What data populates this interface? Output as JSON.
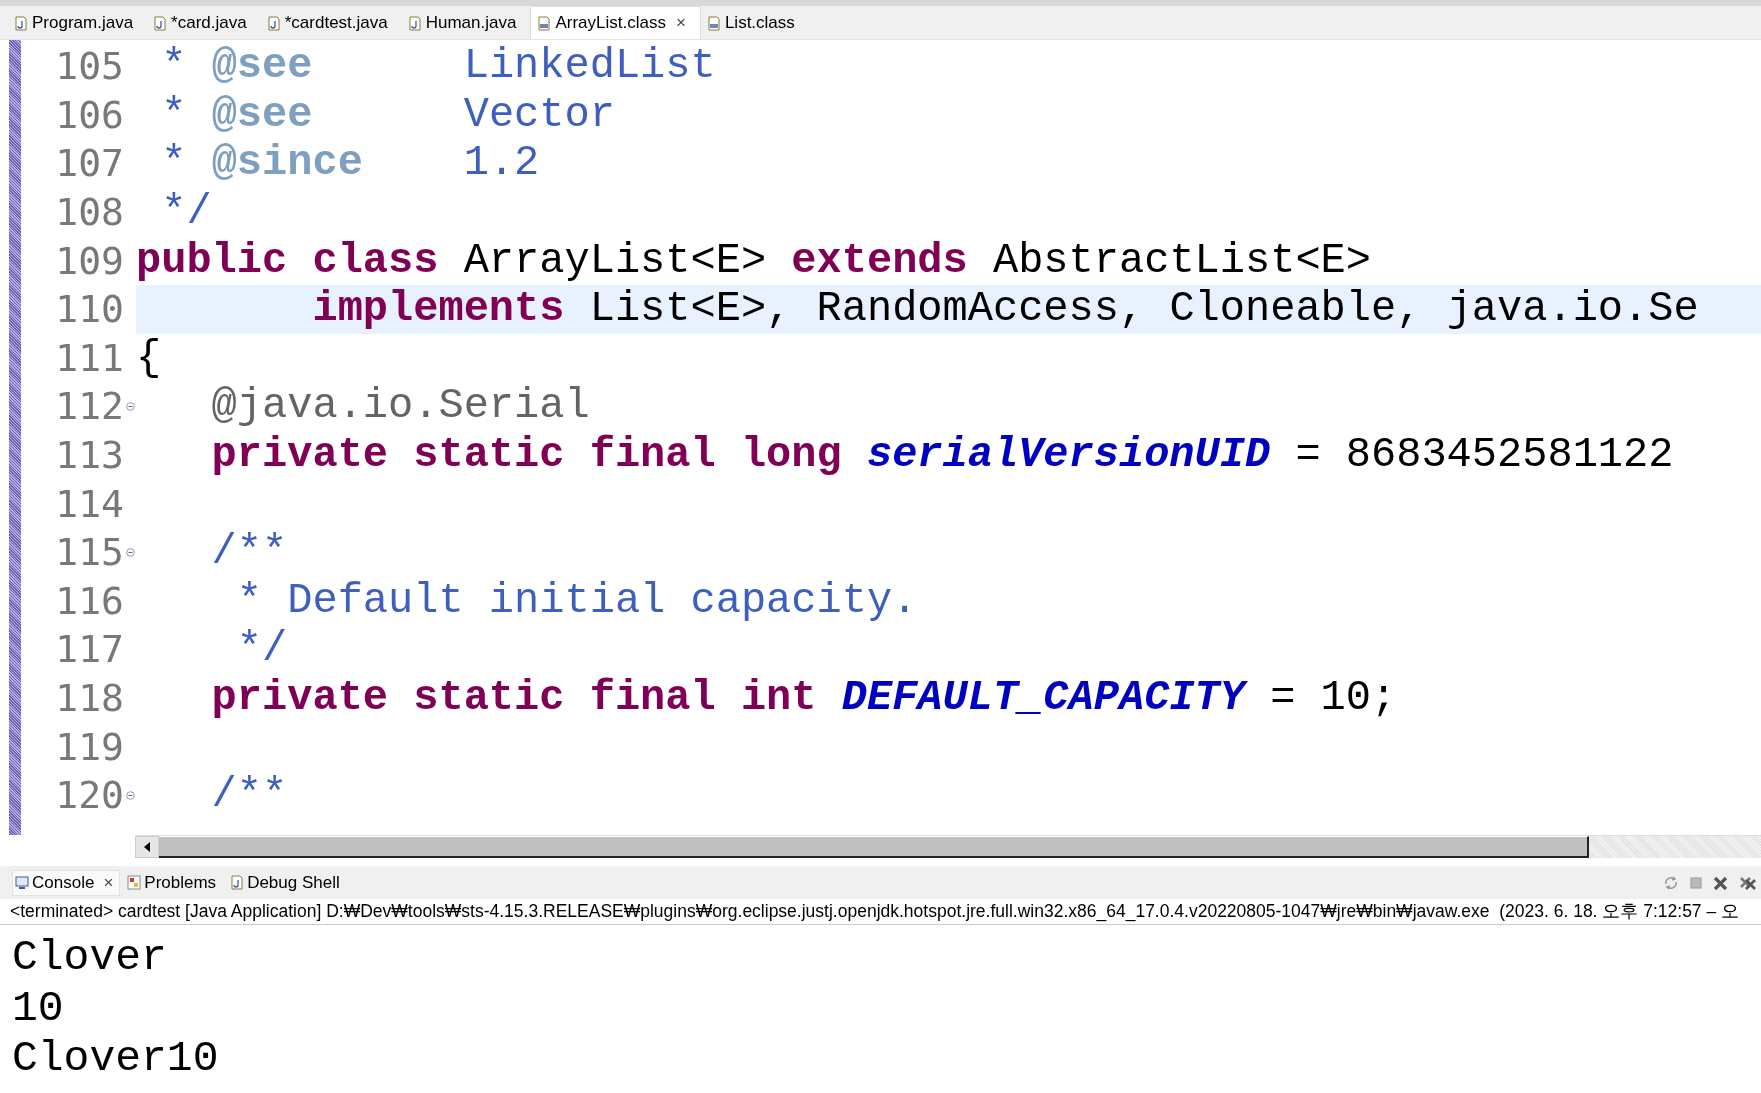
{
  "editor_tabs": [
    {
      "label": "Program.java",
      "kind": "java",
      "selected": false
    },
    {
      "label": "*card.java",
      "kind": "java",
      "selected": false
    },
    {
      "label": "*cardtest.java",
      "kind": "java",
      "selected": false
    },
    {
      "label": "Human.java",
      "kind": "java",
      "selected": false
    },
    {
      "label": "ArrayList.class",
      "kind": "class",
      "selected": true,
      "close": "×"
    },
    {
      "label": "List.class",
      "kind": "class",
      "selected": false
    }
  ],
  "code_lines": [
    {
      "number": "105",
      "fold": false,
      "current": false,
      "tokens": [
        {
          "text": " * ",
          "kind": "comment"
        },
        {
          "text": "@see",
          "kind": "tag"
        },
        {
          "text": "      LinkedList",
          "kind": "comment"
        }
      ]
    },
    {
      "number": "106",
      "fold": false,
      "current": false,
      "tokens": [
        {
          "text": " * ",
          "kind": "comment"
        },
        {
          "text": "@see",
          "kind": "tag"
        },
        {
          "text": "      Vector",
          "kind": "comment"
        }
      ]
    },
    {
      "number": "107",
      "fold": false,
      "current": false,
      "tokens": [
        {
          "text": " * ",
          "kind": "comment"
        },
        {
          "text": "@since",
          "kind": "tag"
        },
        {
          "text": "    1.2",
          "kind": "comment"
        }
      ]
    },
    {
      "number": "108",
      "fold": false,
      "current": false,
      "tokens": [
        {
          "text": " */",
          "kind": "comment"
        }
      ]
    },
    {
      "number": "109",
      "fold": false,
      "current": false,
      "tokens": [
        {
          "text": "public class",
          "kind": "keyword"
        },
        {
          "text": " ArrayList<E> ",
          "kind": "plain"
        },
        {
          "text": "extends",
          "kind": "keyword"
        },
        {
          "text": " AbstractList<E>",
          "kind": "plain"
        }
      ]
    },
    {
      "number": "110",
      "fold": false,
      "current": true,
      "tokens": [
        {
          "text": "       implements",
          "kind": "keyword"
        },
        {
          "text": " List<E>, RandomAccess, Cloneable, java.io.Se",
          "kind": "plain"
        }
      ]
    },
    {
      "number": "111",
      "fold": false,
      "current": false,
      "tokens": [
        {
          "text": "{",
          "kind": "plain"
        }
      ]
    },
    {
      "number": "112",
      "fold": true,
      "current": false,
      "tokens": [
        {
          "text": "   @java.io.Serial",
          "kind": "annotation"
        }
      ]
    },
    {
      "number": "113",
      "fold": false,
      "current": false,
      "tokens": [
        {
          "text": "   private static final long ",
          "kind": "keyword"
        },
        {
          "text": "serialVersionUID",
          "kind": "constant"
        },
        {
          "text": " = 8683452581122",
          "kind": "plain"
        }
      ]
    },
    {
      "number": "114",
      "fold": false,
      "current": false
    },
    {
      "number": "115",
      "fold": true,
      "current": false,
      "tokens": [
        {
          "text": "   /**",
          "kind": "comment"
        }
      ]
    },
    {
      "number": "116",
      "fold": false,
      "current": false,
      "tokens": [
        {
          "text": "    * Default initial capacity.",
          "kind": "comment"
        }
      ]
    },
    {
      "number": "117",
      "fold": false,
      "current": false,
      "tokens": [
        {
          "text": "    */",
          "kind": "comment"
        }
      ]
    },
    {
      "number": "118",
      "fold": false,
      "current": false,
      "tokens": [
        {
          "text": "   private static final int ",
          "kind": "keyword"
        },
        {
          "text": "DEFAULT_CAPACITY",
          "kind": "constant"
        },
        {
          "text": " = 10;",
          "kind": "plain"
        }
      ]
    },
    {
      "number": "119",
      "fold": false,
      "current": false
    },
    {
      "number": "120",
      "fold": true,
      "current": false,
      "tokens": [
        {
          "text": "   /**",
          "kind": "comment"
        }
      ]
    }
  ],
  "console_tabs": [
    {
      "label": "Console",
      "kind": "console",
      "selected": true,
      "close": "×"
    },
    {
      "label": "Problems",
      "kind": "problems",
      "selected": false
    },
    {
      "label": "Debug Shell",
      "kind": "shell",
      "selected": false
    }
  ],
  "console_status": "<terminated> cardtest [Java Application] D:₩Dev₩tools₩sts-4.15.3.RELEASE₩plugins₩org.eclipse.justj.openjdk.hotspot.jre.full.win32.x86_64_17.0.4.v20220805-1047₩jre₩bin₩javaw.exe  (2023. 6. 18. 오후 7:12:57 – 오",
  "console_output": [
    "Clover",
    "10",
    "Clover10"
  ]
}
